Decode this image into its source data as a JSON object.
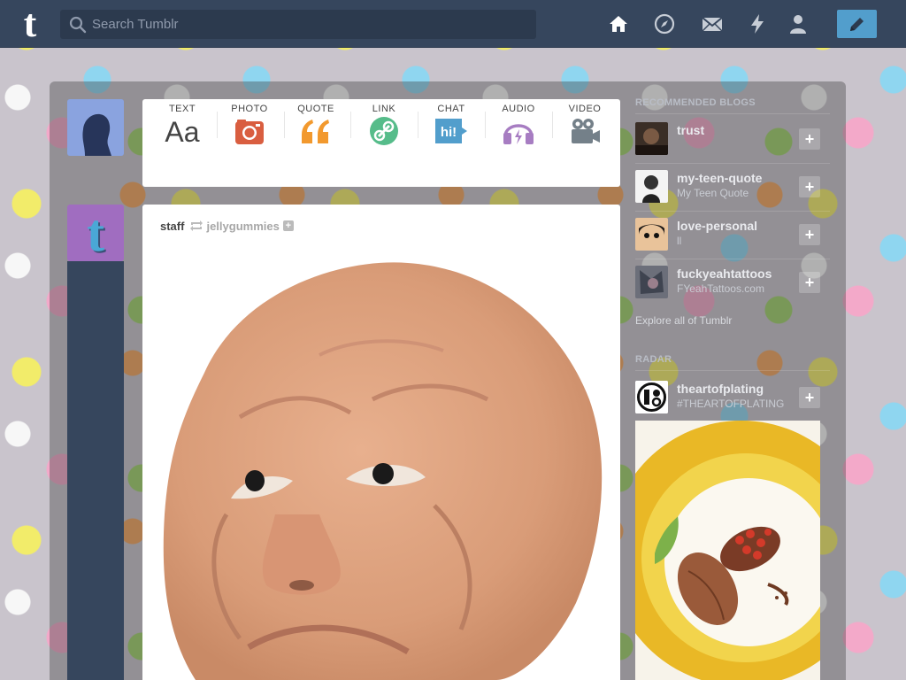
{
  "app": {
    "logo_letter": "t",
    "search": {
      "placeholder": "Search Tumblr",
      "value": ""
    },
    "nav_icons": [
      "home-icon",
      "compass-icon",
      "mail-icon",
      "lightning-icon",
      "account-icon"
    ],
    "compose_icon": "pencil-icon"
  },
  "post_types": [
    {
      "label": "TEXT",
      "glyph": "Aa",
      "color": "#444444"
    },
    {
      "label": "PHOTO",
      "glyph": "camera",
      "color": "#d95e40"
    },
    {
      "label": "QUOTE",
      "glyph": "quote",
      "color": "#f2992e"
    },
    {
      "label": "LINK",
      "glyph": "link",
      "color": "#56bc8a"
    },
    {
      "label": "CHAT",
      "glyph": "hi!",
      "color": "#529ecc"
    },
    {
      "label": "AUDIO",
      "glyph": "headphones",
      "color": "#a77dc2"
    },
    {
      "label": "VIDEO",
      "glyph": "camera-video",
      "color": "#748089"
    }
  ],
  "post": {
    "author": "staff",
    "reblogged_from": "jellygummies",
    "image_alt": "sculpted clay face"
  },
  "sidebar": {
    "recommended_heading": "RECOMMENDED BLOGS",
    "recommended": [
      {
        "name": "trust",
        "title": ""
      },
      {
        "name": "my-teen-quote",
        "title": "My Teen Quote"
      },
      {
        "name": "love-personal",
        "title": "ll"
      },
      {
        "name": "fuckyeahtattoos",
        "title": "FYeahTattoos.com"
      }
    ],
    "follow_label": "+",
    "explore_link": "Explore all of Tumblr",
    "radar_heading": "RADAR",
    "radar": {
      "name": "theartofplating",
      "title": "#THEARTOFPLATING"
    }
  },
  "colors": {
    "navbar": "#36465d",
    "accent": "#529ecc"
  }
}
